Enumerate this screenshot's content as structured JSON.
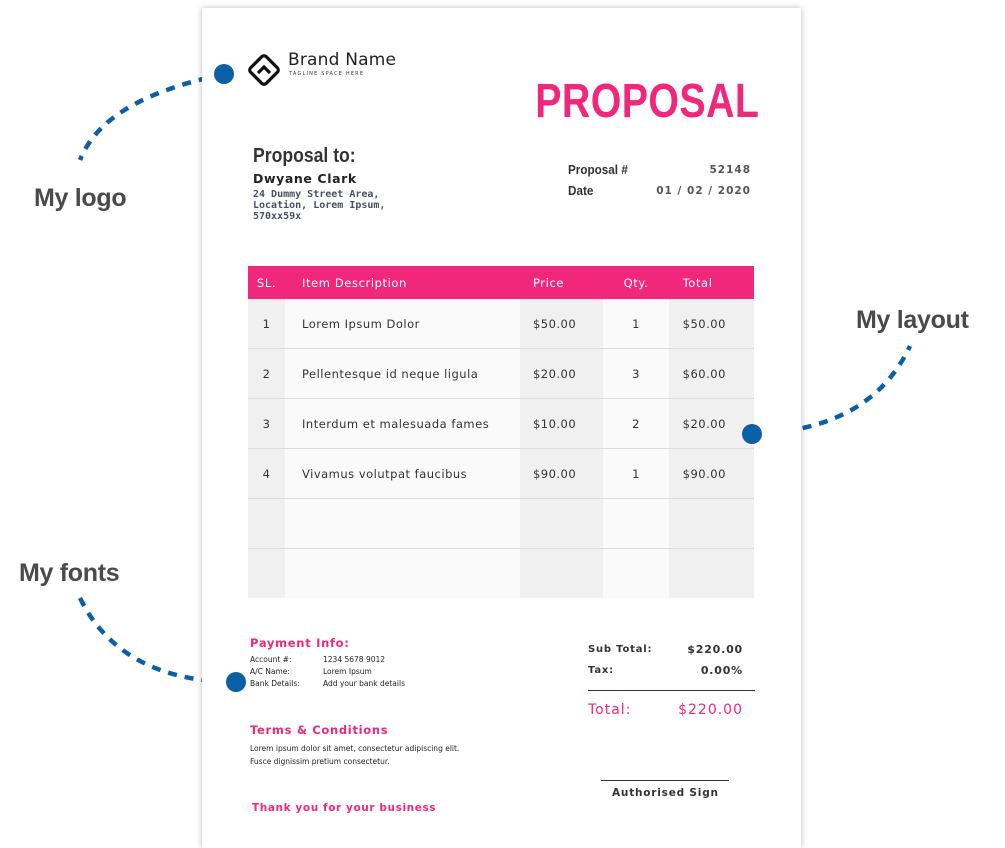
{
  "brand": {
    "name": "Brand Name",
    "tagline": "TAGLINE SPACE HERE",
    "logo_icon": "diamond-chevron-logo-icon"
  },
  "document_title": "PROPOSAL",
  "recipient": {
    "heading": "Proposal to:",
    "name": "Dwyane Clark",
    "address": "24 Dummy Street Area,\nLocation, Lorem Ipsum,\n570xx59x"
  },
  "meta": {
    "proposal_label": "Proposal #",
    "proposal_value": "52148",
    "date_label": "Date",
    "date_value": "01 / 02 / 2020"
  },
  "table": {
    "headers": {
      "sl": "SL.",
      "description": "Item Description",
      "price": "Price",
      "qty": "Qty.",
      "total": "Total"
    },
    "rows": [
      {
        "sl": "1",
        "description": "Lorem Ipsum Dolor",
        "price": "$50.00",
        "qty": "1",
        "total": "$50.00"
      },
      {
        "sl": "2",
        "description": "Pellentesque id neque ligula",
        "price": "$20.00",
        "qty": "3",
        "total": "$60.00"
      },
      {
        "sl": "3",
        "description": "Interdum et malesuada fames",
        "price": "$10.00",
        "qty": "2",
        "total": "$20.00"
      },
      {
        "sl": "4",
        "description": "Vivamus volutpat faucibus",
        "price": "$90.00",
        "qty": "1",
        "total": "$90.00"
      },
      {
        "sl": "",
        "description": "",
        "price": "",
        "qty": "",
        "total": ""
      },
      {
        "sl": "",
        "description": "",
        "price": "",
        "qty": "",
        "total": ""
      }
    ]
  },
  "payment": {
    "heading": "Payment Info:",
    "account_label": "Account #:",
    "account_value": "1234 5678 9012",
    "name_label": "A/C Name:",
    "name_value": "Lorem Ipsum",
    "bank_label": "Bank Details:",
    "bank_value": "Add your bank details"
  },
  "terms": {
    "heading": "Terms & Conditions",
    "line1": "Lorem ipsum dolor sit amet, consectetur adipiscing elit.",
    "line2": "Fusce dignissim pretium consectetur."
  },
  "summary": {
    "subtotal_label": "Sub Total:",
    "subtotal_value": "$220.00",
    "tax_label": "Tax:",
    "tax_value": "0.00%",
    "total_label": "Total:",
    "total_value": "$220.00"
  },
  "sign_label": "Authorised Sign",
  "thanks": "Thank you for your business",
  "callouts": {
    "logo": "My logo",
    "layout": "My layout",
    "fonts": "My fonts"
  },
  "colors": {
    "accent": "#f0277a",
    "callout_dots": "#0b5fa5",
    "callout_text": "#4a4a4a"
  }
}
